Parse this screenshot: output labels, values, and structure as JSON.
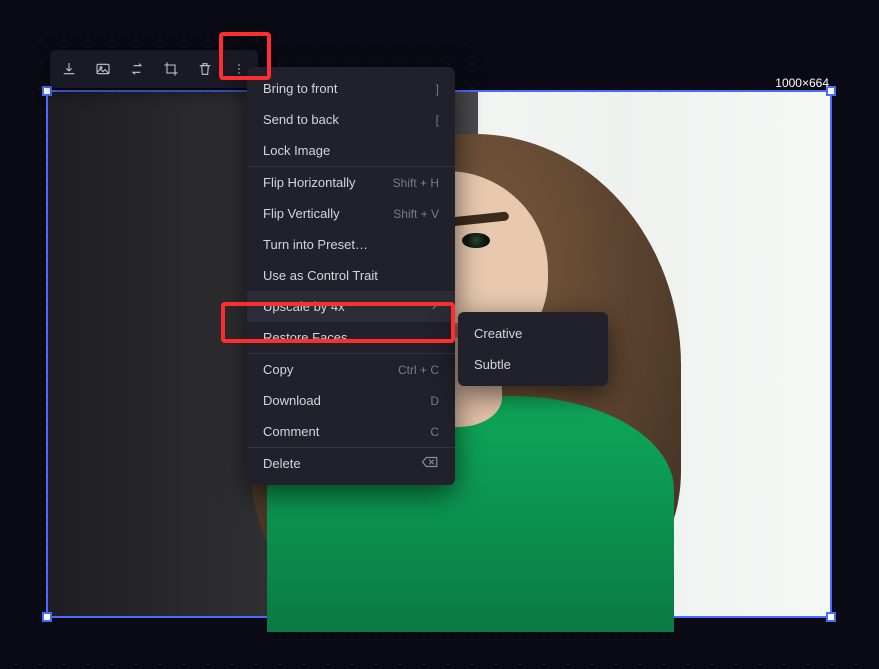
{
  "canvas": {
    "dimensions_label": "1000×664"
  },
  "toolbar": {
    "icons": [
      "download-icon",
      "image-icon",
      "swap-icon",
      "crop-icon",
      "trash-icon",
      "more-icon"
    ]
  },
  "menu": {
    "sections": [
      {
        "items": [
          {
            "label": "Bring to front",
            "shortcut": "]"
          },
          {
            "label": "Send to back",
            "shortcut": "["
          },
          {
            "label": "Lock Image",
            "shortcut": ""
          }
        ]
      },
      {
        "items": [
          {
            "label": "Flip Horizontally",
            "shortcut": "Shift + H"
          },
          {
            "label": "Flip Vertically",
            "shortcut": "Shift + V"
          },
          {
            "label": "Turn into Preset…",
            "shortcut": ""
          },
          {
            "label": "Use as Control Trait",
            "shortcut": ""
          },
          {
            "label": "Upscale by 4x",
            "shortcut": "",
            "has_submenu": true
          },
          {
            "label": "Restore Faces",
            "shortcut": ""
          }
        ]
      },
      {
        "items": [
          {
            "label": "Copy",
            "shortcut": "Ctrl + C"
          },
          {
            "label": "Download",
            "shortcut": "D"
          },
          {
            "label": "Comment",
            "shortcut": "C"
          }
        ]
      },
      {
        "items": [
          {
            "label": "Delete",
            "shortcut": "",
            "trailing_icon": "delete-key-icon"
          }
        ]
      }
    ]
  },
  "submenu": {
    "items": [
      {
        "label": "Creative"
      },
      {
        "label": "Subtle"
      }
    ]
  }
}
